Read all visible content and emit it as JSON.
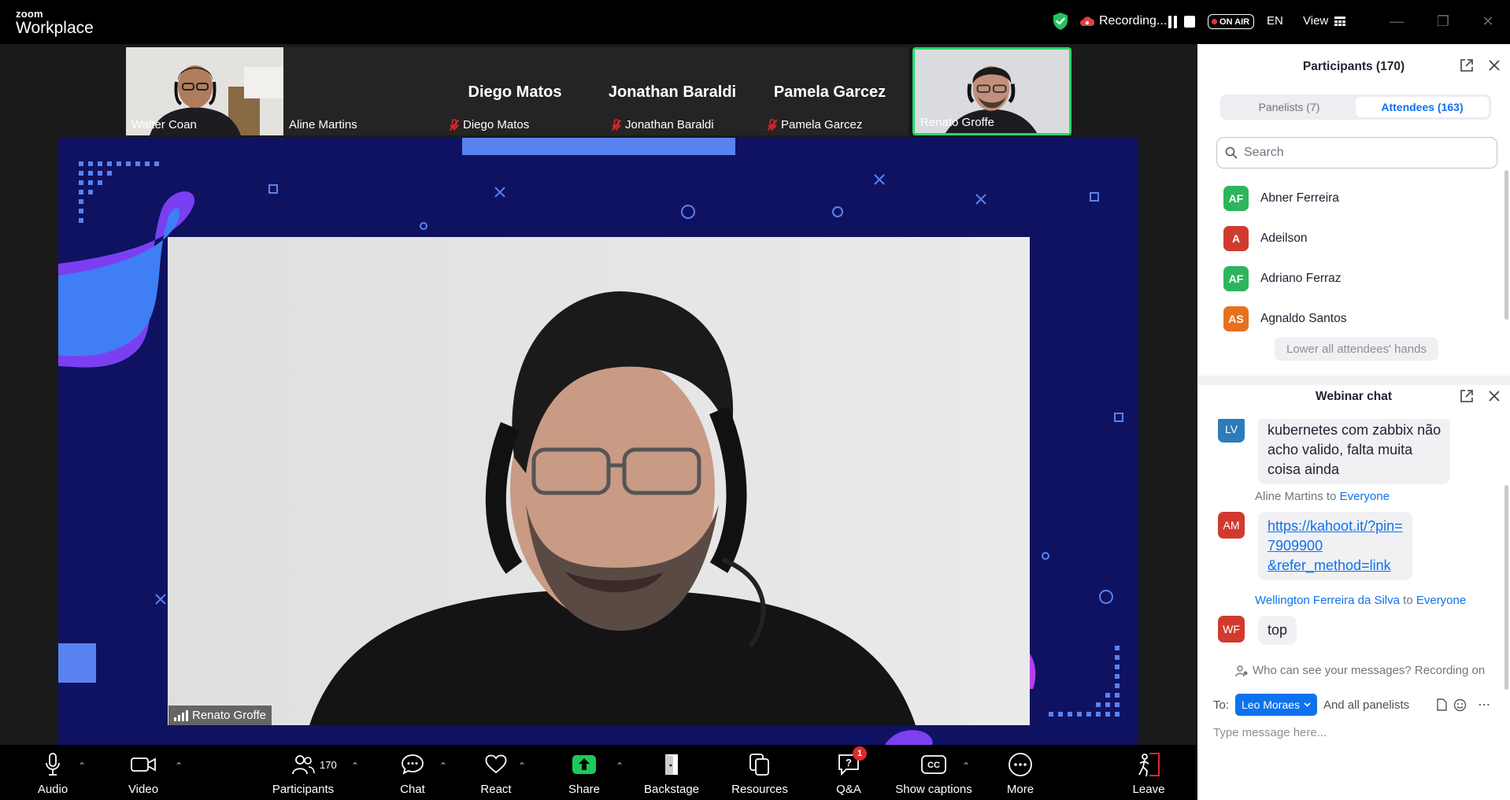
{
  "app": {
    "logo_top": "zoom",
    "logo_bottom": "Workplace"
  },
  "titlebar": {
    "recording_label": "Recording...",
    "on_air_label": "ON AIR",
    "language": "EN",
    "view_label": "View"
  },
  "thumbnails": [
    {
      "name": "Walter Coan",
      "has_video": true,
      "muted": false
    },
    {
      "name": "Aline Martins",
      "has_video": false,
      "muted": false
    },
    {
      "name": "Diego Matos",
      "display_name": "Diego Matos",
      "has_video": false,
      "muted": true
    },
    {
      "name": "Jonathan Baraldi",
      "display_name": "Jonathan Baraldi",
      "has_video": false,
      "muted": true
    },
    {
      "name": "Pamela Garcez",
      "display_name": "Pamela Garcez",
      "has_video": false,
      "muted": true
    },
    {
      "name": "Renato Groffe",
      "has_video": true,
      "muted": false,
      "active_speaker": true
    }
  ],
  "main_video": {
    "name": "Renato Groffe"
  },
  "participants_panel": {
    "title": "Participants (170)",
    "tabs": [
      {
        "label": "Panelists (7)",
        "active": false
      },
      {
        "label": "Attendees (163)",
        "active": true
      }
    ],
    "search_placeholder": "Search",
    "attendees": [
      {
        "initials": "AF",
        "name": "Abner Ferreira",
        "color": "#2db55d"
      },
      {
        "initials": "A",
        "name": "Adeilson",
        "color": "#d13b2f"
      },
      {
        "initials": "AF",
        "name": "Adriano Ferraz",
        "color": "#2db55d"
      },
      {
        "initials": "AS",
        "name": "Agnaldo Santos",
        "color": "#e8701d"
      }
    ],
    "lower_hands_label": "Lower all attendees' hands"
  },
  "chat_panel": {
    "title": "Webinar chat",
    "messages": [
      {
        "initials": "LV",
        "color": "#2d7bb8",
        "text": "kubernetes com zabbix não acho valido, falta muita coisa ainda",
        "lines": [
          "kubernetes com zabbix não",
          "acho valido, falta muita",
          "coisa ainda"
        ]
      },
      {
        "sender": "Aline Martins",
        "to_word": "to",
        "recipient": "Everyone",
        "initials": "AM",
        "color": "#d13b2f",
        "text": "https://kahoot.it/?pin=7909900&refer_method=link",
        "lines": [
          "https://kahoot.it/?pin=",
          "7909900",
          "&refer_method=link"
        ],
        "is_link": true
      },
      {
        "sender": "Wellington Ferreira da Silva",
        "to_word": "to",
        "recipient": "Everyone",
        "initials": "WF",
        "color": "#d13b2f",
        "text": "top"
      }
    ],
    "visibility_note": "Who can see your messages? Recording on",
    "to_label": "To:",
    "to_recipient": "Leo Moraes",
    "and_panelists": "And all panelists",
    "input_placeholder": "Type message here..."
  },
  "toolbar": {
    "audio": "Audio",
    "video": "Video",
    "participants": "Participants",
    "participants_count": "170",
    "chat": "Chat",
    "react": "React",
    "share": "Share",
    "backstage": "Backstage",
    "resources": "Resources",
    "qa": "Q&A",
    "qa_badge": "1",
    "captions": "Show captions",
    "more": "More",
    "leave": "Leave"
  },
  "colors": {
    "accent": "#0e72ed",
    "stage_bg": "#0f1261",
    "active_speaker_border": "#23d96b",
    "share_green": "#1dc95a"
  }
}
